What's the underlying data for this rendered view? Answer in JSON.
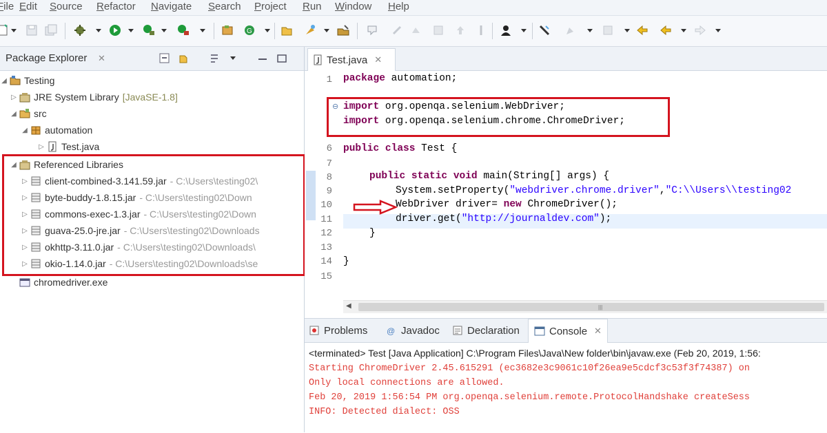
{
  "menu": {
    "items": [
      "File",
      "Edit",
      "Source",
      "Refactor",
      "Navigate",
      "Search",
      "Project",
      "Run",
      "Window",
      "Help"
    ]
  },
  "toolbar": {
    "icons": [
      "new-icon",
      "save-icon",
      "save-all-icon",
      "debug-icon",
      "run-icon",
      "run-last-icon",
      "external-tools-icon",
      "new-java-project-icon",
      "new-package-icon",
      "new-class-icon",
      "open-type-icon",
      "open-task-icon",
      "search-icon",
      "toggle-mark-icon",
      "next-annotation-icon",
      "prev-annotation-icon",
      "last-edit-icon",
      "back-icon",
      "forward-icon"
    ]
  },
  "package_explorer": {
    "title": "Package Explorer",
    "tree": {
      "project": "Testing",
      "jre": {
        "label": "JRE System Library",
        "detail": "[JavaSE-1.8]"
      },
      "src": "src",
      "package": "automation",
      "file": "Test.java",
      "ref_libs": "Referenced Libraries",
      "jars": [
        {
          "name": "client-combined-3.141.59.jar",
          "path": "- C:\\Users\\testing02\\"
        },
        {
          "name": "byte-buddy-1.8.15.jar",
          "path": "- C:\\Users\\testing02\\Down"
        },
        {
          "name": "commons-exec-1.3.jar",
          "path": "- C:\\Users\\testing02\\Down"
        },
        {
          "name": "guava-25.0-jre.jar",
          "path": "- C:\\Users\\testing02\\Downloads"
        },
        {
          "name": "okhttp-3.11.0.jar",
          "path": "- C:\\Users\\testing02\\Downloads\\"
        },
        {
          "name": "okio-1.14.0.jar",
          "path": "- C:\\Users\\testing02\\Downloads\\se"
        }
      ],
      "exe": "chromedriver.exe"
    }
  },
  "editor": {
    "tab": "Test.java",
    "line_numbers": [
      "1",
      "",
      "",
      "6",
      "7",
      "8",
      "9",
      "10",
      "11",
      "12",
      "13",
      "14",
      "15"
    ],
    "code": {
      "l1_kw": "package",
      "l1_rest": " automation;",
      "l3_kw": "import",
      "l3_rest": " org.openqa.selenium.WebDriver;",
      "l4_kw": "import",
      "l4_rest": " org.openqa.selenium.chrome.ChromeDriver;",
      "l6_kw": "public class",
      "l6_rest": " Test {",
      "l8_kw": "public static void",
      "l8_rest": " main(String[] args) {",
      "l9_pre": "System.setProperty(",
      "l9_s1": "\"webdriver.chrome.driver\"",
      "l9_mid": ",",
      "l9_s2": "\"C:\\\\Users\\\\testing02",
      "l10_pre": "WebDriver driver= ",
      "l10_kw": "new",
      "l10_rest": " ChromeDriver();",
      "l11_pre": "driver.get(",
      "l11_str": "\"http://journaldev.com\"",
      "l11_rest": ");",
      "l12": "}",
      "l14": "}"
    }
  },
  "bottom": {
    "tabs": [
      "Problems",
      "Javadoc",
      "Declaration",
      "Console"
    ],
    "active_tab": "Console",
    "console": {
      "terminated": "<terminated> Test [Java Application] C:\\Program Files\\Java\\New folder\\bin\\javaw.exe (Feb 20, 2019, 1:56:",
      "lines": [
        "Starting ChromeDriver 2.45.615291 (ec3682e3c9061c10f26ea9e5cdcf3c53f3f74387) on",
        "Only local connections are allowed.",
        "Feb 20, 2019 1:56:54 PM org.openqa.selenium.remote.ProtocolHandshake createSess",
        "INFO: Detected dialect: OSS"
      ]
    }
  },
  "colors": {
    "keyword": "#7f0055",
    "string": "#2a00ff",
    "console_error": "#e0403a",
    "annotation": "#d4141f"
  }
}
